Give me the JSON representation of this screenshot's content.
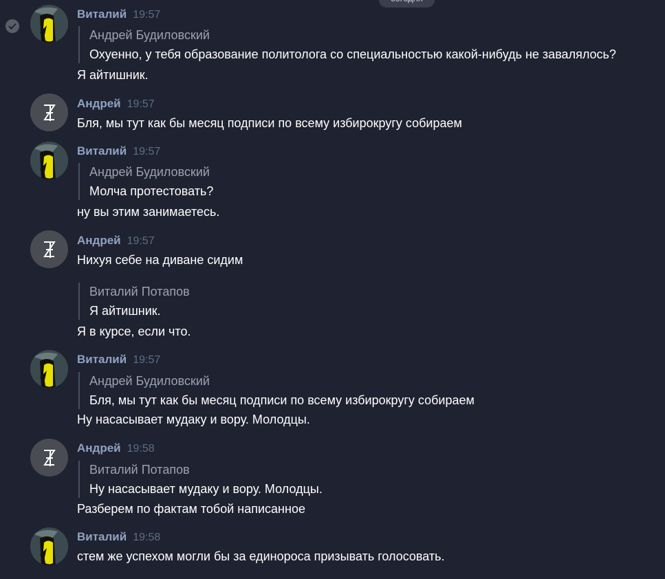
{
  "date_divider": "сегодня",
  "messages": [
    {
      "author": "Виталий",
      "time": "19:57",
      "quote_author": "Андрей Будиловский",
      "quote_text": "Охуенно, у тебя образование политолога со специальностью какой-нибудь не завалялось?",
      "text": "Я айтишник."
    },
    {
      "author": "Андрей",
      "time": "19:57",
      "text": "Бля, мы тут как бы месяц подписи по всему избирокругу собираем"
    },
    {
      "author": "Виталий",
      "time": "19:57",
      "quote_author": "Андрей Будиловский",
      "quote_text": "Молча протестовать?",
      "text": "ну вы этим занимаетесь."
    },
    {
      "author": "Андрей",
      "time": "19:57",
      "text": "Нихуя себе на диване сидим",
      "quote_author": "Виталий Потапов",
      "quote_text": "Я айтишник.",
      "text2": "Я в курсе, если что."
    },
    {
      "author": "Виталий",
      "time": "19:57",
      "quote_author": "Андрей Будиловский",
      "quote_text": "Бля, мы тут как бы месяц подписи по всему избирокругу собираем",
      "text": "Ну насасывает мудаку и вору. Молодцы."
    },
    {
      "author": "Андрей",
      "time": "19:58",
      "quote_author": "Виталий Потапов",
      "quote_text": "Ну насасывает мудаку и вору. Молодцы.",
      "text": "Разберем по фактам тобой написанное"
    },
    {
      "author": "Виталий",
      "time": "19:58",
      "text": "стем же успехом могли бы за единороса призывать голосовать."
    }
  ],
  "colors": {
    "background": "#1f2230",
    "author_name": "#8fa3c2",
    "timestamp": "#5d6f86",
    "quote_bar": "#4a5061"
  },
  "icons": {
    "selected_check": "check-circle-icon",
    "avatar_vitaly": "yellow-figure-avatar",
    "avatar_andrey": "monogram-avatar"
  }
}
